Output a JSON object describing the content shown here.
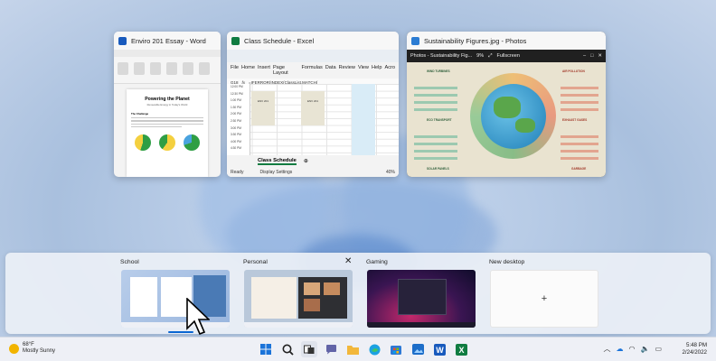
{
  "windows": [
    {
      "title": "Enviro 201 Essay - Word",
      "icon": "word-icon",
      "color": "#185abd"
    },
    {
      "title": "Class Schedule - Excel",
      "icon": "excel-icon",
      "color": "#107c41"
    },
    {
      "title": "Sustainability Figures.jpg - Photos",
      "icon": "photos-icon",
      "color": "#2b7cd3"
    }
  ],
  "word": {
    "heading": "Powering the Planet",
    "subheading": "Renewable Energy in Today's World",
    "section": "The Challenge"
  },
  "excel": {
    "menu": [
      "File",
      "Home",
      "Insert",
      "Page Layout",
      "Formulas",
      "Data",
      "Review",
      "View",
      "Help",
      "Acro"
    ],
    "cell_ref": "G18",
    "formula": "=IFERROR(INDEX(ClassList,MATCH(",
    "times": [
      "12:00 PM",
      "12:30 PM",
      "1:00 PM",
      "1:30 PM",
      "2:00 PM",
      "2:30 PM",
      "3:00 PM",
      "3:30 PM",
      "4:00 PM",
      "4:30 PM"
    ],
    "blocks": [
      "ENV 201",
      "ENV 201"
    ],
    "sheet_tab": "Class Schedule",
    "status_ready": "Ready",
    "status_display": "Display Settings",
    "zoom": "40%"
  },
  "photos": {
    "bar_title": "Photos - Sustainability Fig...",
    "zoom": "9%",
    "fullscreen_label": "Fullscreen",
    "labels": [
      "WIND TURBINES",
      "AIR POLLUTION",
      "ECO TRANSPORT",
      "EXHAUST GASES",
      "SOLAR PANELS",
      "GARBAGE"
    ]
  },
  "desktops": [
    {
      "name": "School",
      "active": true
    },
    {
      "name": "Personal",
      "active": false
    },
    {
      "name": "Gaming",
      "active": false
    },
    {
      "name": "New desktop",
      "active": false
    }
  ],
  "taskbar": {
    "weather_temp": "68°F",
    "weather_desc": "Mostly Sunny",
    "time": "5:48 PM",
    "date": "2/24/2022"
  },
  "colors": {
    "accent": "#0a66d2",
    "word": "#185abd",
    "excel": "#107c41"
  }
}
